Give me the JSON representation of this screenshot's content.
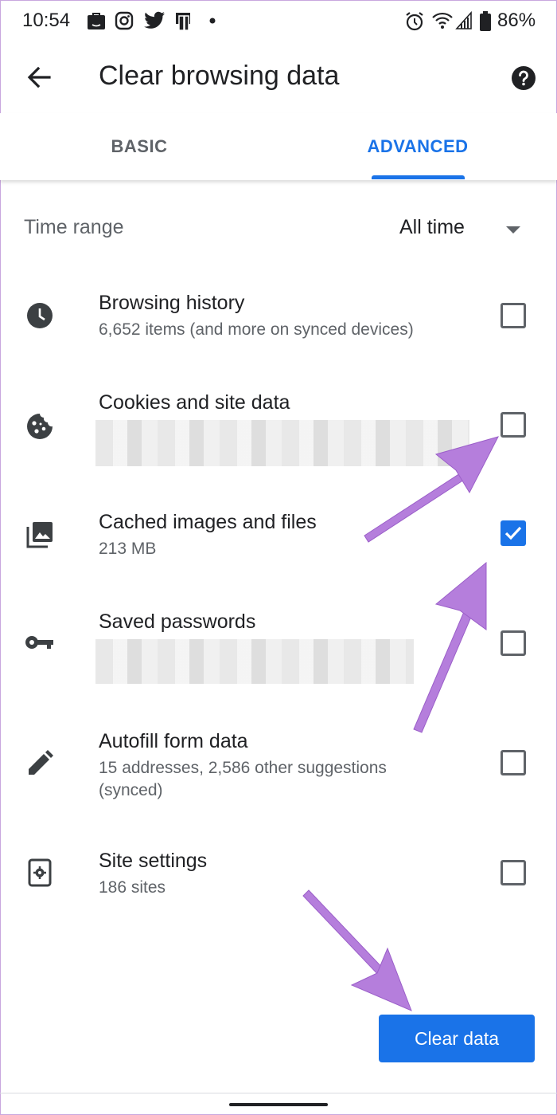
{
  "status_bar": {
    "time": "10:54",
    "battery": "86%"
  },
  "toolbar": {
    "title": "Clear browsing data"
  },
  "tabs": [
    {
      "label": "BASIC"
    },
    {
      "label": "ADVANCED",
      "active": true
    }
  ],
  "time_range": {
    "label": "Time range",
    "value": "All time"
  },
  "items": [
    {
      "title": "Browsing history",
      "subtitle": "6,652 items (and more on synced devices)",
      "checked": false
    },
    {
      "title": "Cookies and site data",
      "subtitle": "",
      "checked": false
    },
    {
      "title": "Cached images and files",
      "subtitle": "213 MB",
      "checked": true
    },
    {
      "title": "Saved passwords",
      "subtitle": "",
      "checked": false
    },
    {
      "title": "Autofill form data",
      "subtitle": "15 addresses, 2,586 other suggestions (synced)",
      "checked": false
    },
    {
      "title": "Site settings",
      "subtitle": "186 sites",
      "checked": false
    }
  ],
  "actions": {
    "clear_label": "Clear data"
  },
  "colors": {
    "accent": "#1a73e8",
    "annotation_arrow": "#b57edc"
  }
}
